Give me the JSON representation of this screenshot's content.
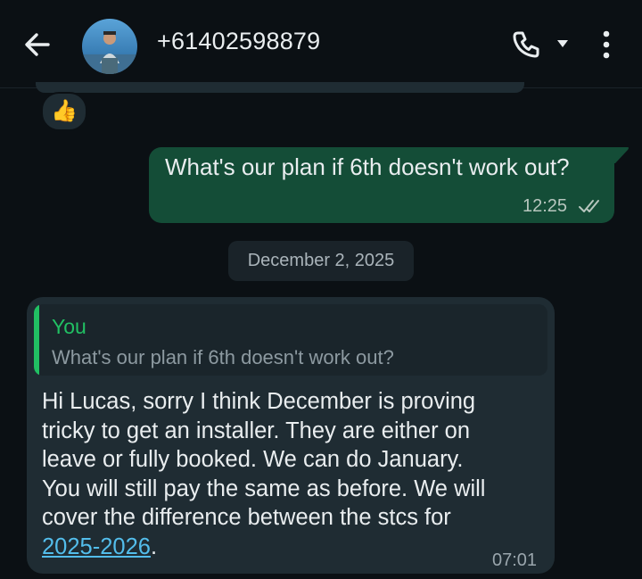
{
  "header": {
    "title": "+61402598879",
    "icons": [
      "back-arrow-icon",
      "avatar",
      "phone-icon",
      "chevron-down-icon",
      "more-vertical-icon"
    ]
  },
  "reaction": {
    "emoji": "👍"
  },
  "messages": [
    {
      "direction": "outgoing",
      "text": "What's our plan if 6th doesn't work out?",
      "time": "12:25",
      "status": "read"
    }
  ],
  "date_separator": "December 2, 2025",
  "incoming": {
    "quote_author": "You",
    "quote_text": "What's our plan if 6th doesn't work out?",
    "lines": [
      "Hi Lucas, sorry I think December is proving",
      "tricky to get an installer. They are either on",
      "leave or fully booked. We can do January.",
      "You will still pay the same as before. We will",
      "cover the difference between the stcs for"
    ],
    "link_text": "2025-2026",
    "after_link": ".",
    "time": "07:01"
  },
  "colors": {
    "background": "#0b1014",
    "outgoing_bubble": "#144d37",
    "incoming_bubble": "#1f2c33",
    "accent_green": "#21c063",
    "link": "#53bdeb"
  }
}
